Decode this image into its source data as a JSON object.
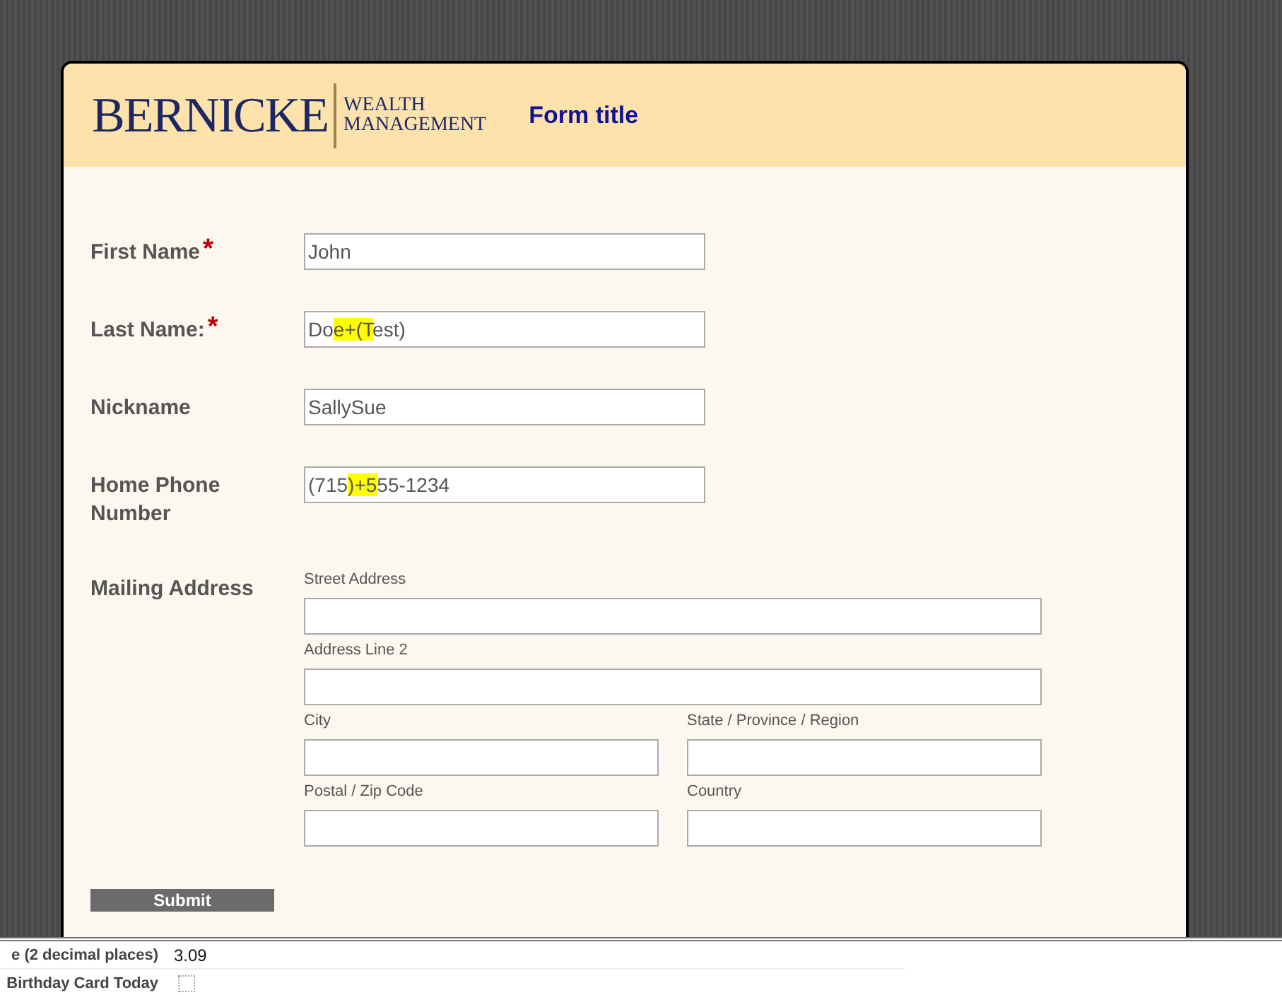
{
  "header": {
    "logo_name": "BERNICKE",
    "logo_tagline": [
      "WEALTH",
      "MANAGEMENT"
    ],
    "form_title": "Form title"
  },
  "fields": [
    {
      "label": "First Name",
      "required": true,
      "value_parts": [
        {
          "text": "John",
          "highlighted": false
        }
      ]
    },
    {
      "label": "Last Name:",
      "required": true,
      "value_parts": [
        {
          "text": "Do",
          "highlighted": false
        },
        {
          "text": "e+(T",
          "highlighted": true
        },
        {
          "text": "est)",
          "highlighted": false
        }
      ]
    },
    {
      "label": "Nickname",
      "required": false,
      "value_parts": [
        {
          "text": "SallySue",
          "highlighted": false
        }
      ]
    },
    {
      "label": "Home Phone Number",
      "required": false,
      "value_parts": [
        {
          "text": "(715",
          "highlighted": false
        },
        {
          "text": ")+5",
          "highlighted": true
        },
        {
          "text": "55-1234",
          "highlighted": false
        }
      ]
    }
  ],
  "required_mark": "*",
  "address": {
    "label": "Mailing Address",
    "rows": [
      [
        {
          "label": "Street Address"
        }
      ],
      [
        {
          "label": "Address Line 2"
        }
      ],
      [
        {
          "label": "City"
        },
        {
          "label": "State / Province / Region"
        }
      ],
      [
        {
          "label": "Postal / Zip Code"
        },
        {
          "label": "Country"
        }
      ]
    ]
  },
  "submit": "Submit",
  "summary": [
    {
      "kind": "text",
      "label": "e (2 decimal places)",
      "value": "3.09"
    },
    {
      "kind": "checkbox",
      "label": "Birthday Card Today",
      "checked": false
    }
  ]
}
